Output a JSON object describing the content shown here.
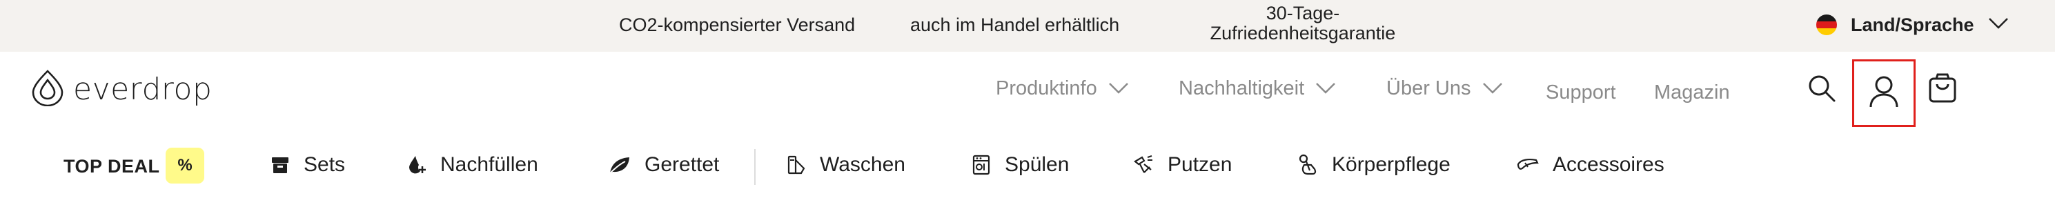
{
  "topbar": {
    "usps": [
      "CO2-kompensierter Versand",
      "auch im Handel erhältlich",
      "30-Tage-Zufriedenheitsgarantie"
    ],
    "usp3_line1": "30-Tage-",
    "usp3_line2": "Zufriedenheitsgarantie",
    "language_label": "Land/Sprache",
    "flag": "germany-flag-icon"
  },
  "header": {
    "brand": "everdrop",
    "nav": [
      {
        "label": "Produktinfo",
        "has_dropdown": true
      },
      {
        "label": "Nachhaltigkeit",
        "has_dropdown": true
      },
      {
        "label": "Über Uns",
        "has_dropdown": true
      },
      {
        "label": "Support",
        "has_dropdown": false
      },
      {
        "label": "Magazin",
        "has_dropdown": false
      }
    ],
    "icons": [
      "search-icon",
      "account-icon",
      "cart-icon"
    ],
    "highlight_color": "#e0201c"
  },
  "categories": {
    "top_deal": "TOP DEAL",
    "badge": "%",
    "badge_color": "#fffa8a",
    "items": [
      {
        "label": "Sets",
        "icon": "box-icon"
      },
      {
        "label": "Nachfüllen",
        "icon": "refill-drop-icon"
      },
      {
        "label": "Gerettet",
        "icon": "leaf-icon"
      },
      {
        "label": "Waschen",
        "icon": "laundry-icon"
      },
      {
        "label": "Spülen",
        "icon": "dishwasher-icon"
      },
      {
        "label": "Putzen",
        "icon": "cleaning-icon"
      },
      {
        "label": "Körperpflege",
        "icon": "bodycare-icon"
      },
      {
        "label": "Accessoires",
        "icon": "accessories-icon"
      }
    ]
  }
}
